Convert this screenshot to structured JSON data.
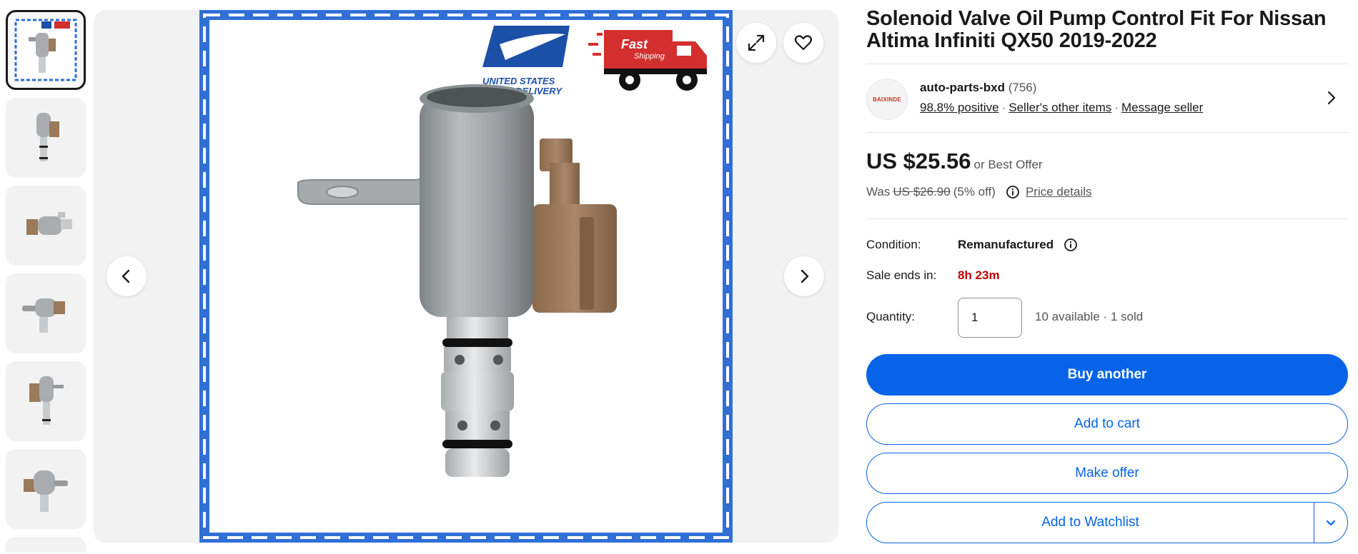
{
  "gallery": {
    "thumbnails": [
      "thumb-1",
      "thumb-2",
      "thumb-3",
      "thumb-4",
      "thumb-5",
      "thumb-6"
    ],
    "badge_usps_line1": "UNITED STATES",
    "badge_usps_line2": "2-7 DAY DELIVERY",
    "badge_fast_line1": "Fast",
    "badge_fast_line2": "Shipping",
    "icons": {
      "expand": "expand-icon",
      "watch": "heart-icon",
      "prev": "chevron-left-icon",
      "next": "chevron-right-icon"
    },
    "colors": {
      "frame_blue": "#2f6fd6",
      "connector_brown": "#9a7a5a"
    }
  },
  "listing": {
    "title": "Solenoid Valve Oil Pump Control Fit For Nissan Altima Infiniti QX50 2019-2022"
  },
  "seller": {
    "logo_text": "BAIXINDE",
    "name": "auto-parts-bxd",
    "feedback_count": "(756)",
    "positive": "98.8% positive",
    "other_items": "Seller's other items",
    "message": "Message seller"
  },
  "price": {
    "current": "US $25.56",
    "best_offer": "or Best Offer",
    "was_label": "Was",
    "was_price": "US $26.90",
    "discount": "(5% off)",
    "details_link": "Price details"
  },
  "details": {
    "condition_label": "Condition:",
    "condition_value": "Remanufactured",
    "sale_label": "Sale ends in:",
    "sale_value": "8h 23m",
    "quantity_label": "Quantity:",
    "quantity_value": "1",
    "availability": "10 available · 1 sold"
  },
  "actions": {
    "buy": "Buy another",
    "cart": "Add to cart",
    "offer": "Make offer",
    "watchlist": "Add to Watchlist"
  },
  "colors": {
    "primary": "#0764e8",
    "sale_red": "#c00000"
  }
}
